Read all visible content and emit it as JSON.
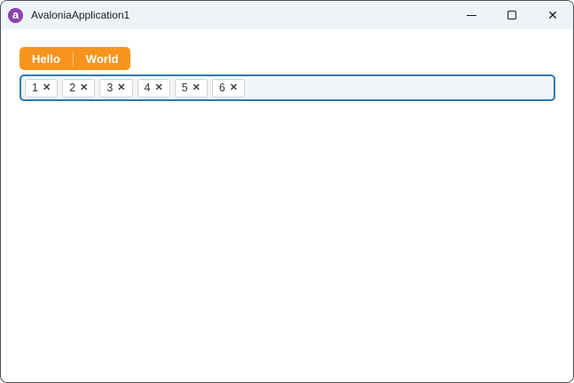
{
  "window": {
    "title": "AvaloniaApplication1",
    "app_icon_letter": "a",
    "controls": {
      "close_glyph": "✕"
    }
  },
  "toolbar": {
    "buttons": [
      {
        "label": "Hello"
      },
      {
        "label": "World"
      }
    ]
  },
  "chips": {
    "items": [
      {
        "label": "1"
      },
      {
        "label": "2"
      },
      {
        "label": "3"
      },
      {
        "label": "4"
      },
      {
        "label": "5"
      },
      {
        "label": "6"
      }
    ],
    "remove_glyph": "✕"
  },
  "colors": {
    "accent_orange": "#f7941e",
    "focus_border_blue": "#2b7bb5",
    "titlebar_bg": "#eef3f8",
    "logo_purple": "#8b44ac"
  }
}
